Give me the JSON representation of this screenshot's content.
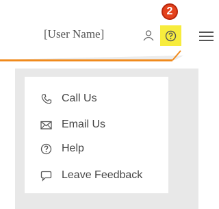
{
  "header": {
    "user_name": "[User Name]",
    "badge_number": "2",
    "icons": [
      "user-icon",
      "help-icon",
      "hamburger-menu-icon"
    ],
    "accent_color": "#f08a1c",
    "highlight_color": "#f7ec3d",
    "badge_color": "#e4421c"
  },
  "help_menu": {
    "items": [
      {
        "label": "Call Us",
        "icon": "phone-icon"
      },
      {
        "label": "Email Us",
        "icon": "envelope-icon"
      },
      {
        "label": "Help",
        "icon": "question-circle-icon"
      },
      {
        "label": "Leave Feedback",
        "icon": "speech-bubble-icon"
      }
    ]
  }
}
